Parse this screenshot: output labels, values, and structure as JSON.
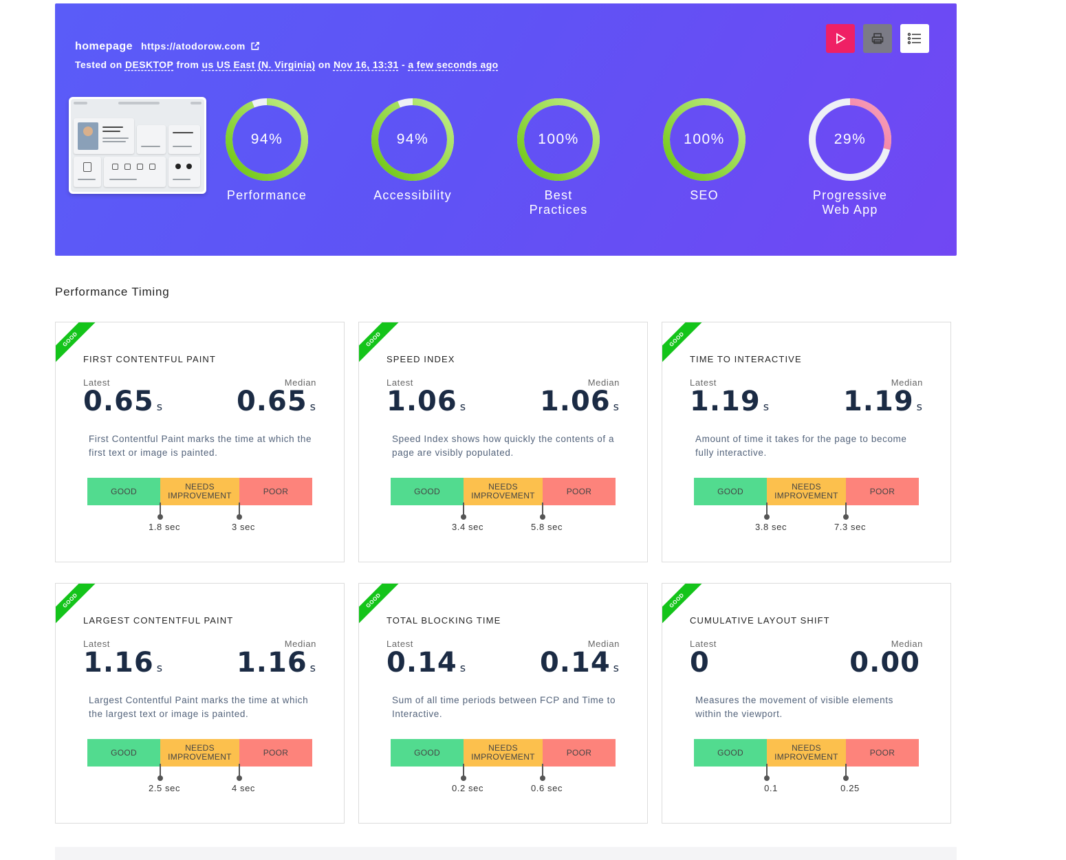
{
  "hero": {
    "page_name": "homepage",
    "url": "https://atodorow.com",
    "tested_on_prefix": "Tested on",
    "device": "DESKTOP",
    "from_word": "from",
    "location": "us US East (N. Virginia)",
    "on_word": "on",
    "date": "Nov 16, 13:31",
    "dash": "-",
    "relative_time": "a few seconds ago",
    "buttons": [
      {
        "name": "run-test-button",
        "icon": "play-icon",
        "color": "#ef2065"
      },
      {
        "name": "print-button",
        "icon": "printer-icon",
        "color": "#7b7b86"
      },
      {
        "name": "list-button",
        "icon": "list-icon",
        "color": "#ffffff"
      }
    ],
    "gauges": [
      {
        "value_text": "94%",
        "value": 94,
        "label_line1": "Performance",
        "label_line2": "",
        "status": "good"
      },
      {
        "value_text": "94%",
        "value": 94,
        "label_line1": "Accessibility",
        "label_line2": "",
        "status": "good"
      },
      {
        "value_text": "100%",
        "value": 100,
        "label_line1": "Best",
        "label_line2": "Practices",
        "status": "good"
      },
      {
        "value_text": "100%",
        "value": 100,
        "label_line1": "SEO",
        "label_line2": "",
        "status": "good"
      },
      {
        "value_text": "29%",
        "value": 29,
        "label_line1": "Progressive",
        "label_line2": "Web App",
        "status": "poor"
      }
    ]
  },
  "section": {
    "title": "Performance Timing"
  },
  "legend": {
    "good": "GOOD",
    "needs": "NEEDS IMPROVEMENT",
    "poor": "POOR",
    "latest": "Latest",
    "median": "Median"
  },
  "cards": [
    {
      "badge": "GOOD",
      "title": "FIRST CONTENTFUL PAINT",
      "latest": "0.65",
      "median": "0.65",
      "unit": "s",
      "desc": "First Contentful Paint marks the time at which the first text or image is painted.",
      "t1": "1.8 sec",
      "t2": "3 sec"
    },
    {
      "badge": "GOOD",
      "title": "SPEED INDEX",
      "latest": "1.06",
      "median": "1.06",
      "unit": "s",
      "desc": "Speed Index shows how quickly the contents of a page are visibly populated.",
      "t1": "3.4 sec",
      "t2": "5.8 sec"
    },
    {
      "badge": "GOOD",
      "title": "TIME TO INTERACTIVE",
      "latest": "1.19",
      "median": "1.19",
      "unit": "s",
      "desc": "Amount of time it takes for the page to become fully interactive.",
      "t1": "3.8 sec",
      "t2": "7.3 sec"
    },
    {
      "badge": "GOOD",
      "title": "LARGEST CONTENTFUL PAINT",
      "latest": "1.16",
      "median": "1.16",
      "unit": "s",
      "desc": "Largest Contentful Paint marks the time at which the largest text or image is painted.",
      "t1": "2.5 sec",
      "t2": "4 sec"
    },
    {
      "badge": "GOOD",
      "title": "TOTAL BLOCKING TIME",
      "latest": "0.14",
      "median": "0.14",
      "unit": "s",
      "desc": "Sum of all time periods between FCP and Time to Interactive.",
      "t1": "0.2 sec",
      "t2": "0.6 sec"
    },
    {
      "badge": "GOOD",
      "title": "CUMULATIVE LAYOUT SHIFT",
      "latest": "0",
      "median": "0.00",
      "unit": "",
      "desc": "Measures the movement of visible elements within the viewport.",
      "t1": "0.1",
      "t2": "0.25"
    }
  ],
  "colors": {
    "good": "#52db8f",
    "needs": "#fcc04d",
    "poor": "#fd837b",
    "ribbon": "#14c41a",
    "gauge_good": "#6cc50e",
    "gauge_poor": "#f0507f"
  }
}
